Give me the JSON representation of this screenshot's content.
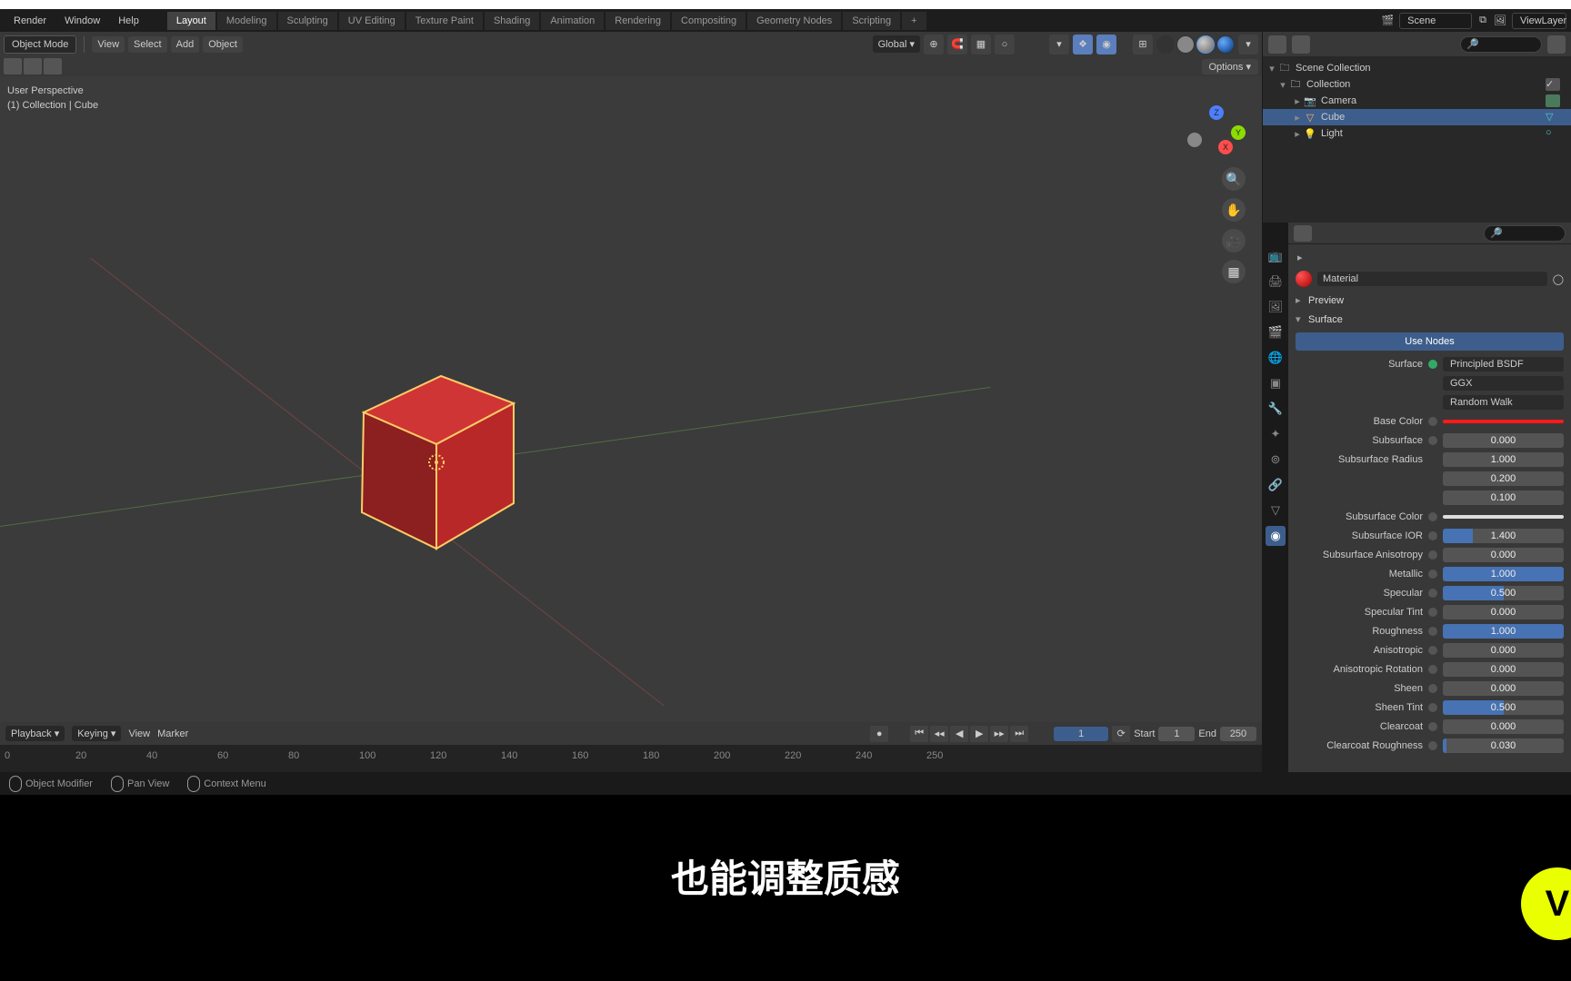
{
  "menu": {
    "render": "Render",
    "window": "Window",
    "help": "Help"
  },
  "workspaces": [
    "Layout",
    "Modeling",
    "Sculpting",
    "UV Editing",
    "Texture Paint",
    "Shading",
    "Animation",
    "Rendering",
    "Compositing",
    "Geometry Nodes",
    "Scripting"
  ],
  "scene_label": "Scene",
  "viewlayer_label": "ViewLayer",
  "vp": {
    "mode": "Object Mode",
    "view": "View",
    "select": "Select",
    "add": "Add",
    "object": "Object",
    "orientation": "Global",
    "options": "Options ▾",
    "info1": "User Perspective",
    "info2": "(1) Collection | Cube"
  },
  "outliner": {
    "root": "Scene Collection",
    "collection": "Collection",
    "items": [
      {
        "name": "Camera"
      },
      {
        "name": "Cube"
      },
      {
        "name": "Light"
      }
    ]
  },
  "props": {
    "material_name": "Material",
    "preview": "Preview",
    "surface_panel": "Surface",
    "use_nodes": "Use Nodes",
    "surface_label": "Surface",
    "surface_value": "Principled BSDF",
    "dist": "GGX",
    "sss": "Random Walk",
    "rows": [
      {
        "label": "Base Color",
        "type": "color"
      },
      {
        "label": "Subsurface",
        "val": "0.000",
        "fill": 0
      },
      {
        "label": "Subsurface Radius",
        "val": "1.000",
        "fill": 0,
        "nodot": true
      },
      {
        "label": "",
        "val": "0.200",
        "fill": 0,
        "nodot": true,
        "nolabel": true
      },
      {
        "label": "",
        "val": "0.100",
        "fill": 0,
        "nodot": true,
        "nolabel": true
      },
      {
        "label": "Subsurface Color",
        "type": "subcolor"
      },
      {
        "label": "Subsurface IOR",
        "val": "1.400",
        "fill": 25
      },
      {
        "label": "Subsurface Anisotropy",
        "val": "0.000",
        "fill": 0
      },
      {
        "label": "Metallic",
        "val": "1.000",
        "fill": 100
      },
      {
        "label": "Specular",
        "val": "0.500",
        "fill": 50
      },
      {
        "label": "Specular Tint",
        "val": "0.000",
        "fill": 0
      },
      {
        "label": "Roughness",
        "val": "1.000",
        "fill": 100
      },
      {
        "label": "Anisotropic",
        "val": "0.000",
        "fill": 0
      },
      {
        "label": "Anisotropic Rotation",
        "val": "0.000",
        "fill": 0
      },
      {
        "label": "Sheen",
        "val": "0.000",
        "fill": 0
      },
      {
        "label": "Sheen Tint",
        "val": "0.500",
        "fill": 50
      },
      {
        "label": "Clearcoat",
        "val": "0.000",
        "fill": 0
      },
      {
        "label": "Clearcoat Roughness",
        "val": "0.030",
        "fill": 3
      }
    ]
  },
  "timeline": {
    "mode": "Playback ▾",
    "keying": "Keying ▾",
    "view": "View",
    "marker": "Marker",
    "current": "1",
    "start_l": "Start",
    "start_v": "1",
    "end_l": "End",
    "end_v": "250",
    "ticks": [
      "0",
      "20",
      "40",
      "60",
      "80",
      "100",
      "120",
      "140",
      "160",
      "180",
      "200",
      "220",
      "240",
      "250"
    ]
  },
  "status": {
    "modifier": "Object Modifier",
    "pan": "Pan View",
    "ctx": "Context Menu"
  },
  "subtitle": "也能调整质感"
}
